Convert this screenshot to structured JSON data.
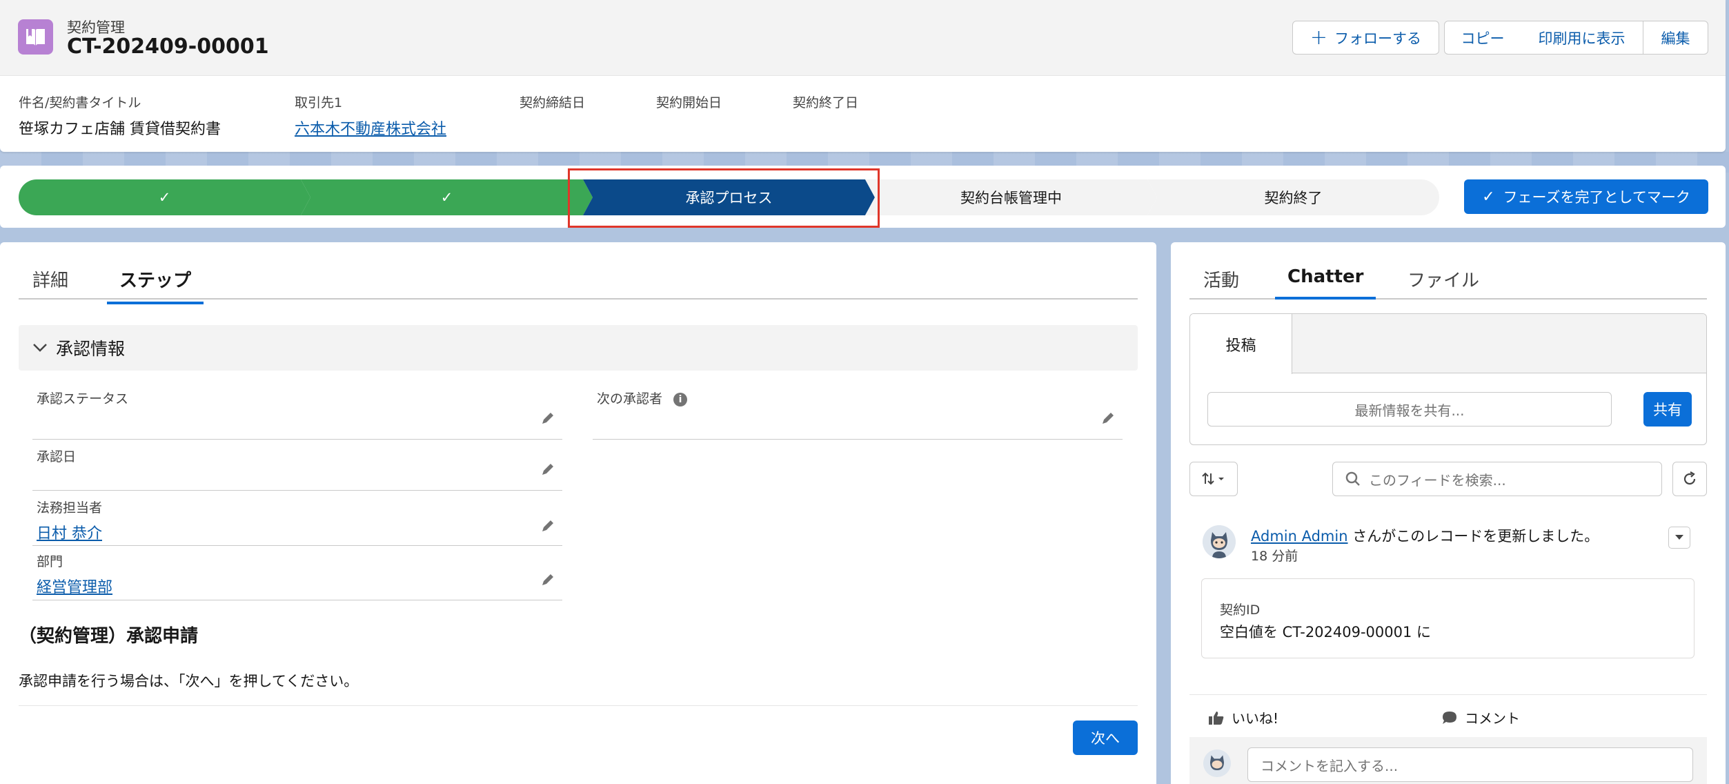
{
  "record": {
    "object_type": "契約管理",
    "name": "CT-202409-00001",
    "icon": "book-icon",
    "accent_color": "#b781d3"
  },
  "header_actions": {
    "follow": "フォローする",
    "copy": "コピー",
    "print": "印刷用に表示",
    "edit": "編集"
  },
  "highlights": [
    {
      "label": "件名/契約書タイトル",
      "value": "笹塚カフェ店舗 賃貸借契約書"
    },
    {
      "label": "取引先1",
      "value": "六本木不動産株式会社"
    },
    {
      "label": "契約締結日",
      "value": ""
    },
    {
      "label": "契約開始日",
      "value": ""
    },
    {
      "label": "契約終了日",
      "value": ""
    }
  ],
  "path": {
    "stages": [
      {
        "label": "✓",
        "status": "done"
      },
      {
        "label": "✓",
        "status": "done"
      },
      {
        "label": "承認プロセス",
        "status": "current"
      },
      {
        "label": "契約台帳管理中",
        "status": "todo"
      },
      {
        "label": "契約終了",
        "status": "todo"
      }
    ],
    "mark_complete": "フェーズを完了としてマーク",
    "colors": {
      "done": "#3ba755",
      "current": "#0b4a8a",
      "highlight": "#e0362a"
    }
  },
  "main_tabs": [
    {
      "label": "詳細",
      "active": false
    },
    {
      "label": "ステップ",
      "active": true
    }
  ],
  "approval_section": {
    "title": "承認情報",
    "fields": {
      "status": {
        "label": "承認ステータス",
        "value": ""
      },
      "next_approver": {
        "label": "次の承認者",
        "value": ""
      },
      "approval_date": {
        "label": "承認日",
        "value": ""
      },
      "legal_owner": {
        "label": "法務担当者",
        "value": "日村 恭介"
      },
      "department": {
        "label": "部門",
        "value": "経営管理部"
      }
    }
  },
  "approval_request": {
    "title": "（契約管理）承認申請",
    "description": "承認申請を行う場合は、「次へ」を押してください。",
    "next_button": "次へ"
  },
  "side_tabs": [
    {
      "label": "活動",
      "active": false
    },
    {
      "label": "Chatter",
      "active": true
    },
    {
      "label": "ファイル",
      "active": false
    }
  ],
  "publisher": {
    "tab": "投稿",
    "placeholder": "最新情報を共有...",
    "share_button": "共有"
  },
  "feed_search": {
    "placeholder": "このフィードを検索..."
  },
  "feed_item": {
    "author": "Admin Admin",
    "action_text": "さんがこのレコードを更新しました。",
    "time": "18 分前",
    "change_field": "契約ID",
    "change_value": "空白値を CT-202409-00001 に",
    "like": "いいね!",
    "comment": "コメント",
    "comment_placeholder": "コメントを記入する..."
  }
}
